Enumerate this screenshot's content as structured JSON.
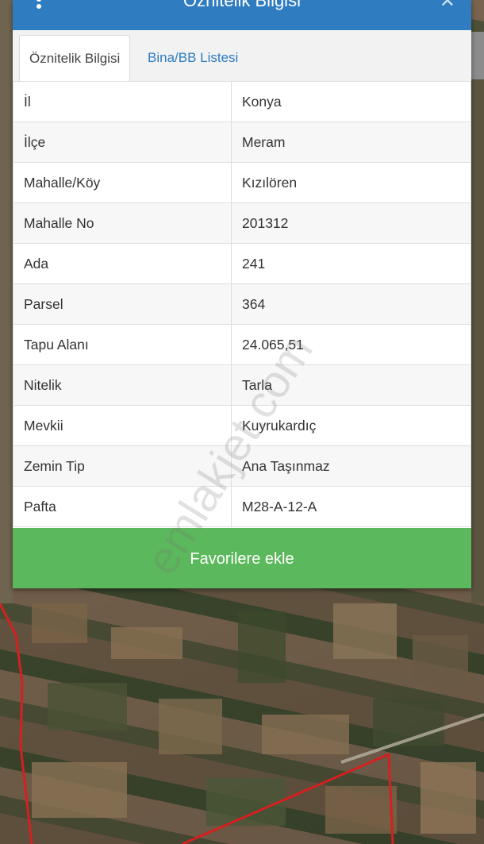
{
  "dialog": {
    "title": "Öznitelik Bilgisi",
    "tabs": [
      {
        "label": "Öznitelik Bilgisi",
        "active": true
      },
      {
        "label": "Bina/BB Listesi",
        "active": false
      }
    ],
    "rows": [
      {
        "key": "İl",
        "value": "Konya"
      },
      {
        "key": "İlçe",
        "value": "Meram"
      },
      {
        "key": "Mahalle/Köy",
        "value": "Kızılören"
      },
      {
        "key": "Mahalle No",
        "value": "201312"
      },
      {
        "key": "Ada",
        "value": "241"
      },
      {
        "key": "Parsel",
        "value": "364"
      },
      {
        "key": "Tapu Alanı",
        "value": "24.065,51"
      },
      {
        "key": "Nitelik",
        "value": "Tarla"
      },
      {
        "key": "Mevkii",
        "value": "Kuyrukardıç"
      },
      {
        "key": "Zemin Tip",
        "value": "Ana Taşınmaz"
      },
      {
        "key": "Pafta",
        "value": "M28-A-12-A"
      }
    ],
    "favorite_button": "Favorilere ekle",
    "close_icon": "close-icon",
    "menu_icon": "menu-dots-icon"
  },
  "watermark": "emlakjet.com",
  "colors": {
    "title_bar": "#2f7cc1",
    "tab_link": "#2f7cc1",
    "favorite_button": "#5cb85c",
    "parcel_boundary": "#d42020"
  }
}
